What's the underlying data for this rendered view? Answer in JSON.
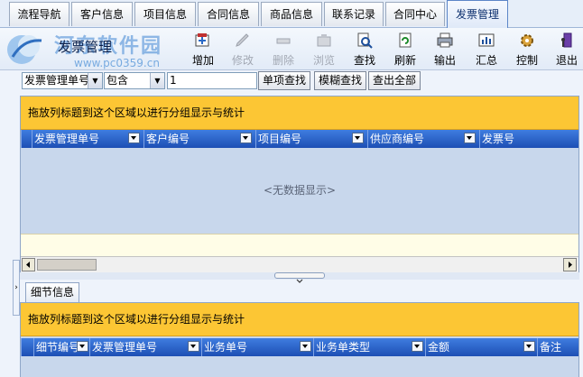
{
  "tabs": [
    {
      "label": "流程导航",
      "active": false
    },
    {
      "label": "客户信息",
      "active": false
    },
    {
      "label": "项目信息",
      "active": false
    },
    {
      "label": "合同信息",
      "active": false
    },
    {
      "label": "商品信息",
      "active": false
    },
    {
      "label": "联系记录",
      "active": false
    },
    {
      "label": "合同中心",
      "active": false
    },
    {
      "label": "发票管理",
      "active": true
    }
  ],
  "module": {
    "title": "发票管理"
  },
  "watermark": {
    "text": "河东软件园",
    "url": "www.pc0359.cn"
  },
  "toolbar": {
    "add": {
      "label": "增加",
      "icon": "add-icon",
      "enabled": true
    },
    "edit": {
      "label": "修改",
      "icon": "edit-icon",
      "enabled": false
    },
    "delete": {
      "label": "删除",
      "icon": "delete-icon",
      "enabled": false
    },
    "browse": {
      "label": "浏览",
      "icon": "browse-icon",
      "enabled": false
    },
    "find": {
      "label": "查找",
      "icon": "find-icon",
      "enabled": true
    },
    "refresh": {
      "label": "刷新",
      "icon": "refresh-icon",
      "enabled": true
    },
    "export": {
      "label": "输出",
      "icon": "print-icon",
      "enabled": true
    },
    "summary": {
      "label": "汇总",
      "icon": "summary-icon",
      "enabled": true
    },
    "control": {
      "label": "控制",
      "icon": "gear-icon",
      "enabled": true
    },
    "exit": {
      "label": "退出",
      "icon": "exit-icon",
      "enabled": true
    }
  },
  "search": {
    "field": "发票管理单号",
    "operator": "包含",
    "value": "1",
    "single_button": "单项查找",
    "fuzzy_button": "模糊查找",
    "show_all_button": "查出全部"
  },
  "main_grid": {
    "group_hint": "拖放列标题到这个区域以进行分组显示与统计",
    "columns": [
      "发票管理单号",
      "客户编号",
      "项目编号",
      "供应商编号",
      "发票号"
    ],
    "empty_text": "<无数据显示>"
  },
  "detail": {
    "tab_label": "细节信息",
    "group_hint": "拖放列标题到这个区域以进行分组显示与统计",
    "columns": [
      "细节编号",
      "发票管理单号",
      "业务单号",
      "业务单类型",
      "金额",
      "备注"
    ]
  },
  "colors": {
    "accent": "#2356c0",
    "group_band": "#fcc634",
    "grid_bg": "#c8d7ec"
  }
}
